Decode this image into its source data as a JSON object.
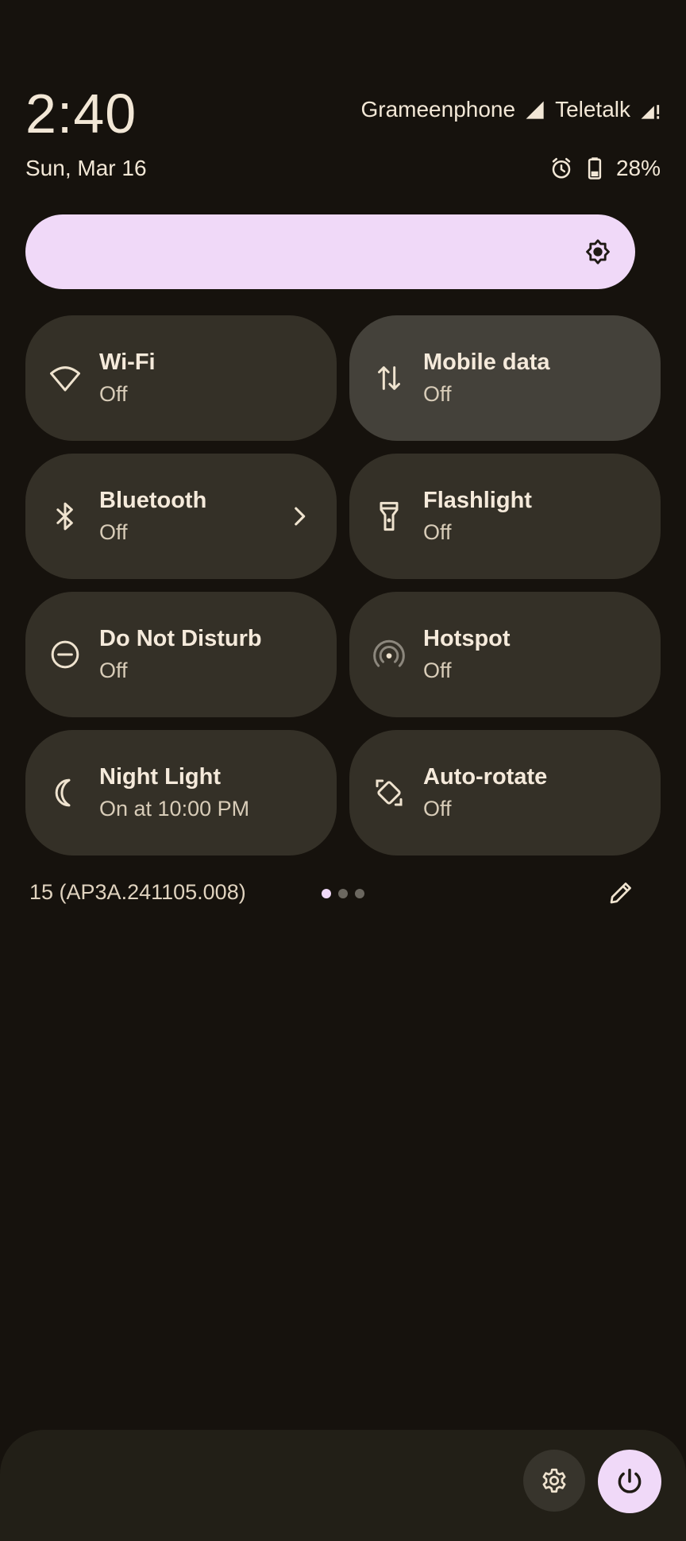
{
  "status": {
    "time": "2:40",
    "date": "Sun, Mar 16",
    "carriers": [
      "Grameenphone",
      "Teletalk"
    ],
    "battery": "28%"
  },
  "brightness": {
    "icon": "brightness-icon"
  },
  "tiles": [
    {
      "label": "Wi-Fi",
      "sub": "Off",
      "icon": "wifi-icon"
    },
    {
      "label": "Mobile data",
      "sub": "Off",
      "icon": "mobile-data-icon"
    },
    {
      "label": "Bluetooth",
      "sub": "Off",
      "icon": "bluetooth-icon"
    },
    {
      "label": "Flashlight",
      "sub": "Off",
      "icon": "flashlight-icon"
    },
    {
      "label": "Do Not Disturb",
      "sub": "Off",
      "icon": "do-not-disturb-icon"
    },
    {
      "label": "Hotspot",
      "sub": "Off",
      "icon": "hotspot-icon"
    },
    {
      "label": "Night Light",
      "sub": "On at 10:00 PM",
      "icon": "night-light-icon"
    },
    {
      "label": "Auto-rotate",
      "sub": "Off",
      "icon": "auto-rotate-icon"
    }
  ],
  "footer": {
    "build": "15 (AP3A.241105.008)"
  },
  "colors": {
    "background": "#16120d",
    "tile": "#343027",
    "tile_highlight": "#44413a",
    "accent": "#f0d9f8",
    "text": "#f5eadb"
  }
}
